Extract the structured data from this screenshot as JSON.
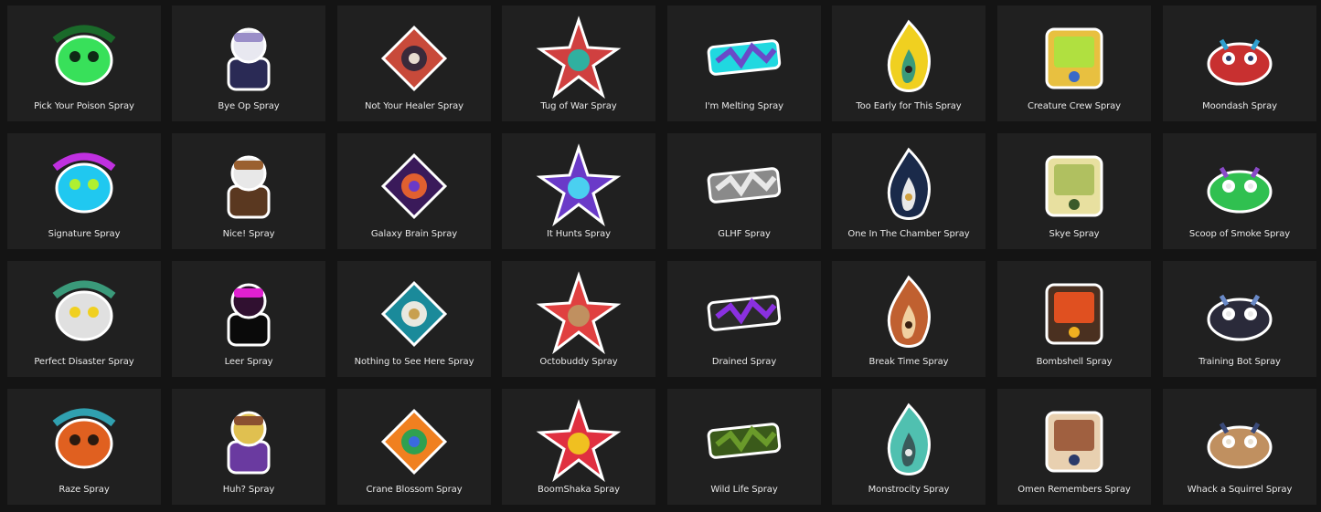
{
  "sprays": [
    {
      "label": "Pick Your Poison Spray",
      "icon": "poison-icon",
      "colors": [
        "#38e05a",
        "#1a6a2a",
        "#0f2a15"
      ]
    },
    {
      "label": "Bye Op Spray",
      "icon": "bye-op-icon",
      "colors": [
        "#9a8ec8",
        "#2a2a55",
        "#e8e8f0"
      ]
    },
    {
      "label": "Not Your Healer Spray",
      "icon": "healer-icon",
      "colors": [
        "#c84a3a",
        "#3a2a3a",
        "#e8dcd0"
      ]
    },
    {
      "label": "Tug of War Spray",
      "icon": "tug-of-war-icon",
      "colors": [
        "#d04040",
        "#30b0a0",
        "#8a5a30"
      ]
    },
    {
      "label": "I'm Melting Spray",
      "icon": "melting-icon",
      "colors": [
        "#6a4ac8",
        "#20d8e0",
        "#1a1535"
      ]
    },
    {
      "label": "Too Early for This Spray",
      "icon": "too-early-icon",
      "colors": [
        "#f0d020",
        "#3a9a7a",
        "#2a2020"
      ]
    },
    {
      "label": "Creature Crew Spray",
      "icon": "creature-crew-icon",
      "colors": [
        "#b0e040",
        "#3a6ac8",
        "#e8c040"
      ]
    },
    {
      "label": "Moondash Spray",
      "icon": "moondash-icon",
      "colors": [
        "#c83030",
        "#30a0d0",
        "#2a3a6a"
      ]
    },
    {
      "label": "Signature Spray",
      "icon": "signature-icon",
      "colors": [
        "#20c8f0",
        "#c030e0",
        "#b0f030"
      ]
    },
    {
      "label": "Nice! Spray",
      "icon": "nice-icon",
      "colors": [
        "#9a6030",
        "#5a3820",
        "#e8e8e8"
      ]
    },
    {
      "label": "Galaxy Brain Spray",
      "icon": "galaxy-brain-icon",
      "colors": [
        "#3a1a5a",
        "#e06030",
        "#6a3ac8"
      ]
    },
    {
      "label": "It Hunts Spray",
      "icon": "it-hunts-icon",
      "colors": [
        "#6a3ac8",
        "#4ad0f0",
        "#2a1a4a"
      ]
    },
    {
      "label": "GLHF Spray",
      "icon": "glhf-icon",
      "colors": [
        "#e8e8e8",
        "#8a8a8a",
        "#4a4a4a"
      ]
    },
    {
      "label": "One In The Chamber Spray",
      "icon": "chamber-icon",
      "colors": [
        "#1a2a4a",
        "#e8e8e8",
        "#d0a040"
      ]
    },
    {
      "label": "Skye Spray",
      "icon": "skye-icon",
      "colors": [
        "#b0c060",
        "#3a5a2a",
        "#e8e0a0"
      ]
    },
    {
      "label": "Scoop of Smoke Spray",
      "icon": "scoop-icon",
      "colors": [
        "#30c050",
        "#8a4ac8",
        "#e8e8e8"
      ]
    },
    {
      "label": "Perfect Disaster Spray",
      "icon": "perfect-disaster-icon",
      "colors": [
        "#e0e0e0",
        "#3a9a7a",
        "#f0d020"
      ]
    },
    {
      "label": "Leer Spray",
      "icon": "leer-icon",
      "colors": [
        "#e020d0",
        "#0a0a0a",
        "#301030"
      ]
    },
    {
      "label": "Nothing to See Here Spray",
      "icon": "nothing-to-see-icon",
      "colors": [
        "#1a8a9a",
        "#e8e8e0",
        "#c8a050"
      ]
    },
    {
      "label": "Octobuddy Spray",
      "icon": "octobuddy-icon",
      "colors": [
        "#e04040",
        "#c09060",
        "#6a4020"
      ]
    },
    {
      "label": "Drained Spray",
      "icon": "drained-icon",
      "colors": [
        "#8a30e0",
        "#2a2a2a",
        "#40e0c0"
      ]
    },
    {
      "label": "Break Time Spray",
      "icon": "break-time-icon",
      "colors": [
        "#c06030",
        "#f0d0a0",
        "#3a2010"
      ]
    },
    {
      "label": "Bombshell Spray",
      "icon": "bombshell-icon",
      "colors": [
        "#e05020",
        "#f0b020",
        "#4a3020"
      ]
    },
    {
      "label": "Training Bot Spray",
      "icon": "training-bot-icon",
      "colors": [
        "#2a2a3a",
        "#6a8ac8",
        "#e8e8e8"
      ]
    },
    {
      "label": "Raze Spray",
      "icon": "raze-icon",
      "colors": [
        "#e06020",
        "#30a0b0",
        "#2a1a10"
      ]
    },
    {
      "label": "Huh? Spray",
      "icon": "huh-icon",
      "colors": [
        "#8a5030",
        "#6a3aa0",
        "#e0c050"
      ]
    },
    {
      "label": "Crane Blossom Spray",
      "icon": "crane-blossom-icon",
      "colors": [
        "#f08020",
        "#30a050",
        "#3a6ae0"
      ]
    },
    {
      "label": "BoomShaka Spray",
      "icon": "boomshaka-icon",
      "colors": [
        "#e03040",
        "#f0c020",
        "#30c0a0"
      ]
    },
    {
      "label": "Wild Life Spray",
      "icon": "wild-life-icon",
      "colors": [
        "#6a9a2a",
        "#3a5a1a",
        "#8ab040"
      ]
    },
    {
      "label": "Monstrocity Spray",
      "icon": "monstrocity-icon",
      "colors": [
        "#50c0b0",
        "#3a5a5a",
        "#e8e8e8"
      ]
    },
    {
      "label": "Omen Remembers Spray",
      "icon": "omen-remembers-icon",
      "colors": [
        "#a06040",
        "#2a3a6a",
        "#e8d0b0"
      ]
    },
    {
      "label": "Whack a Squirrel Spray",
      "icon": "whack-squirrel-icon",
      "colors": [
        "#c09060",
        "#3a4a7a",
        "#e8e0d0"
      ]
    }
  ]
}
